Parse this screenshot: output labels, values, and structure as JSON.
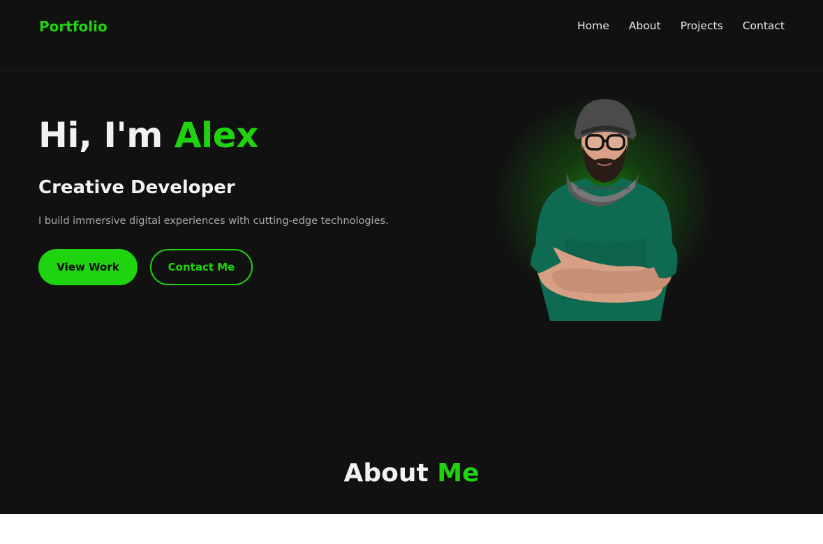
{
  "nav": {
    "logo": "Portfolio",
    "links": [
      "Home",
      "About",
      "Projects",
      "Contact"
    ]
  },
  "hero": {
    "greeting": "Hi, I'm",
    "name": "Alex",
    "subtitle": "Creative Developer",
    "description": "I build immersive digital experiences with cutting-edge technologies.",
    "primary_button": "View Work",
    "secondary_button": "Contact Me",
    "portrait_icon": "person-portrait-image"
  },
  "about": {
    "title_main": "About",
    "title_accent": "Me"
  },
  "colors": {
    "accent": "#1fd40e",
    "background": "#111111",
    "text": "#f2f2f2",
    "muted_text": "#a8a8a8"
  }
}
